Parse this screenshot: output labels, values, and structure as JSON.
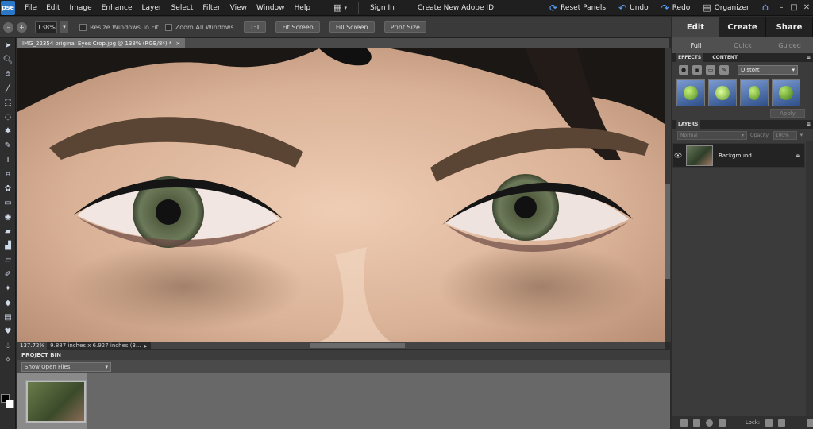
{
  "app": {
    "logo": "pse"
  },
  "menu": {
    "items": [
      "File",
      "Edit",
      "Image",
      "Enhance",
      "Layer",
      "Select",
      "Filter",
      "View",
      "Window",
      "Help"
    ],
    "sign_in": "Sign In",
    "create_id": "Create New Adobe ID",
    "reset_panels": "Reset Panels",
    "undo": "Undo",
    "redo": "Redo",
    "organizer": "Organizer"
  },
  "options": {
    "zoom_value": "138%",
    "resize_windows": "Resize Windows To Fit",
    "zoom_all": "Zoom All Windows",
    "one_to_one": "1:1",
    "fit_screen": "Fit Screen",
    "fill_screen": "Fill Screen",
    "print_size": "Print Size"
  },
  "document": {
    "tab_title": "IMG_22354 original Eyes Crop.jpg @ 138% (RGB/8*) *",
    "tab_close": "×",
    "zoom_status": "137.72%",
    "info": "9.887 inches x 6.927 inches (3..."
  },
  "project_bin": {
    "title": "PROJECT BIN",
    "select_value": "Show Open Files"
  },
  "panel": {
    "modes": [
      "Edit",
      "Create",
      "Share"
    ],
    "sub_tabs": [
      "Full",
      "Quick",
      "Guided"
    ],
    "effects_tab": "EFFECTS",
    "content_tab": "CONTENT",
    "effect_category": "Distort",
    "apply": "Apply",
    "layers_title": "LAYERS",
    "blend_mode": "Normal",
    "opacity_label": "Opacity:",
    "opacity_value": "100%",
    "layer_name": "Background",
    "lock_label": "Lock:"
  },
  "icons": [
    "layout-icon",
    "reset-panels-icon",
    "undo-icon",
    "redo-icon",
    "organizer-icon",
    "home-icon",
    "eye-icon",
    "lock-icon"
  ],
  "colors": {
    "accent": "#2c78c8",
    "foreground": "#000000",
    "background": "#ffffff"
  }
}
